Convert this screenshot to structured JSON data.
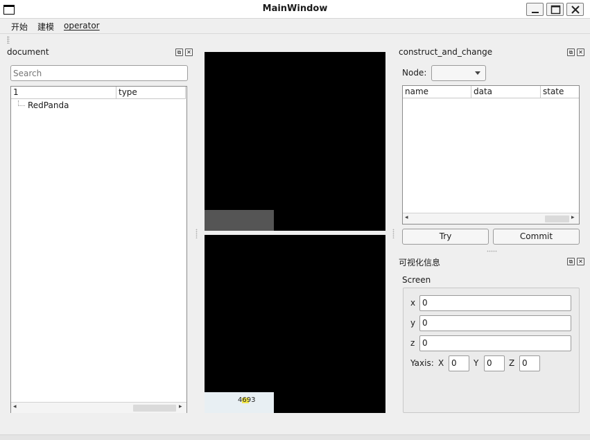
{
  "window": {
    "title": "MainWindow",
    "icon": "window-icon",
    "controls": [
      "minimize-icon",
      "maximize-icon",
      "close-icon"
    ]
  },
  "menu": {
    "items": [
      "开始",
      "建模",
      "operator"
    ]
  },
  "document_dock": {
    "title": "document",
    "search_placeholder": "Search",
    "columns": [
      "1",
      "type"
    ],
    "rows": [
      {
        "name": "RedPanda",
        "type": ""
      }
    ]
  },
  "viewports": {
    "bottom_overlay_text": "4693"
  },
  "construct_dock": {
    "title": "construct_and_change",
    "node_label": "Node:",
    "node_value": "",
    "columns": [
      "name",
      "data",
      "state"
    ],
    "try_label": "Try",
    "commit_label": "Commit"
  },
  "visual_dock": {
    "title": "可视化信息",
    "group_title": "Screen",
    "x_label": "x",
    "x_value": "0",
    "y_label": "y",
    "y_value": "0",
    "z_label": "z",
    "z_value": "0",
    "yaxis_label": "Yaxis:",
    "yaxis_x_label": "X",
    "yaxis_x_value": "0",
    "yaxis_y_label": "Y",
    "yaxis_y_value": "0",
    "yaxis_z_label": "Z",
    "yaxis_z_value": "0"
  },
  "colors": {
    "background": "#efefef",
    "viewport": "#000000",
    "overlay_gray": "#555555"
  }
}
